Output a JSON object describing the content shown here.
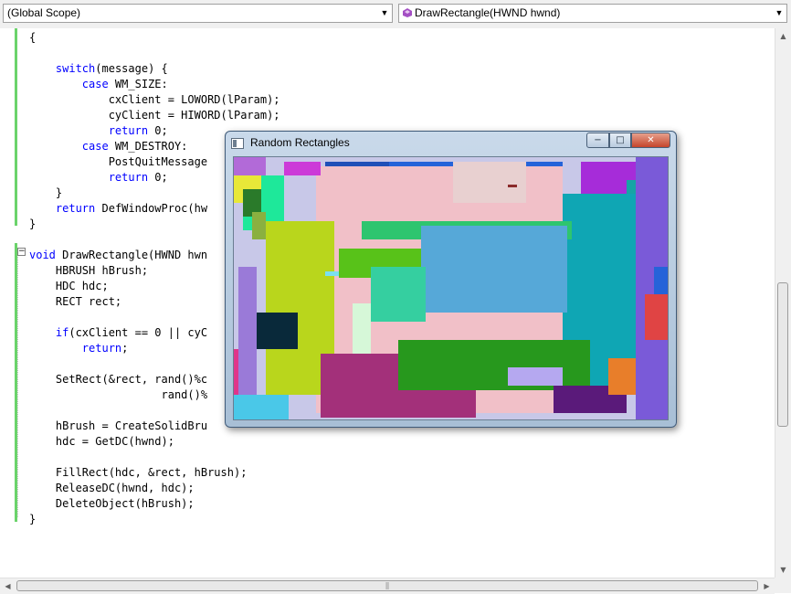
{
  "scope_combo": {
    "value": "(Global Scope)"
  },
  "member_combo": {
    "value": "DrawRectangle(HWND hwnd)",
    "icon": "method-icon",
    "icon_color": "#a44fc4"
  },
  "code_lines": [
    {
      "html": "{"
    },
    {
      "html": ""
    },
    {
      "html": "    <span class=\"kw\">switch</span>(message) {"
    },
    {
      "html": "        <span class=\"kw\">case</span> WM_SIZE:"
    },
    {
      "html": "            cxClient = LOWORD(lParam);"
    },
    {
      "html": "            cyClient = HIWORD(lParam);"
    },
    {
      "html": "            <span class=\"kw\">return</span> 0;"
    },
    {
      "html": "        <span class=\"kw\">case</span> WM_DESTROY:"
    },
    {
      "html": "            PostQuitMessage"
    },
    {
      "html": "            <span class=\"kw\">return</span> 0;"
    },
    {
      "html": "    }"
    },
    {
      "html": "    <span class=\"kw\">return</span> DefWindowProc(hw"
    },
    {
      "html": "}"
    },
    {
      "html": ""
    },
    {
      "html": "<span class=\"kw\">void</span> DrawRectangle(HWND hwn"
    },
    {
      "html": "    HBRUSH hBrush;"
    },
    {
      "html": "    HDC hdc;"
    },
    {
      "html": "    RECT rect;"
    },
    {
      "html": ""
    },
    {
      "html": "    <span class=\"kw\">if</span>(cxClient == 0 || cyC"
    },
    {
      "html": "        <span class=\"kw\">return</span>;"
    },
    {
      "html": ""
    },
    {
      "html": "    SetRect(&amp;rect, rand()%c"
    },
    {
      "html": "                    rand()%"
    },
    {
      "html": ""
    },
    {
      "html": "    hBrush = CreateSolidBru"
    },
    {
      "html": "    hdc = GetDC(hwnd);"
    },
    {
      "html": ""
    },
    {
      "html": "    FillRect(hdc, &amp;rect, hBrush);"
    },
    {
      "html": "    ReleaseDC(hwnd, hdc);"
    },
    {
      "html": "    DeleteObject(hBrush);"
    },
    {
      "html": "}"
    }
  ],
  "app_window": {
    "title": "Random Rectangles",
    "min_label": "−",
    "max_label": "□",
    "close_label": "✕"
  },
  "colors": {
    "keyword": "#0000ff",
    "change_bar": "#6bd36b"
  }
}
